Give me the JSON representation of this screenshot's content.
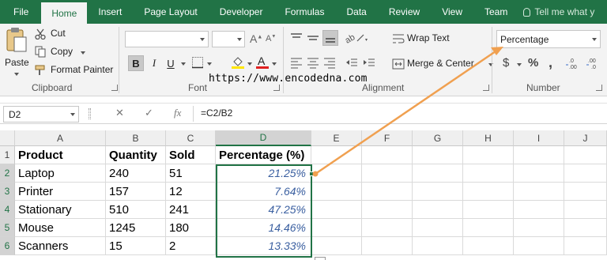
{
  "tabs": [
    "File",
    "Home",
    "Insert",
    "Page Layout",
    "Developer",
    "Formulas",
    "Data",
    "Review",
    "View",
    "Team"
  ],
  "tell_me": "Tell me what y",
  "clipboard": {
    "paste": "Paste",
    "cut": "Cut",
    "copy": "Copy",
    "format_painter": "Format Painter",
    "group_label": "Clipboard"
  },
  "font": {
    "bold": "B",
    "italic": "I",
    "underline": "U",
    "font_color_glyph": "A",
    "group_label": "Font"
  },
  "alignment": {
    "wrap_text": "Wrap Text",
    "merge_center": "Merge & Center",
    "group_label": "Alignment"
  },
  "number": {
    "format": "Percentage",
    "currency": "$",
    "percent": "%",
    "comma": ",",
    "group_label": "Number"
  },
  "watermark": "https://www.encodedna.com",
  "formula_bar": {
    "name_box": "D2",
    "fx": "fx",
    "formula": "=C2/B2"
  },
  "columns": [
    "A",
    "B",
    "C",
    "D",
    "E",
    "F",
    "G",
    "H",
    "I",
    "J"
  ],
  "rows": [
    "1",
    "2",
    "3",
    "4",
    "5",
    "6"
  ],
  "table": {
    "headers": [
      "Product",
      "Quantity",
      "Sold",
      "Percentage (%)"
    ],
    "rows": [
      [
        "Laptop",
        "240",
        "51",
        "21.25%"
      ],
      [
        "Printer",
        "157",
        "12",
        "7.64%"
      ],
      [
        "Stationary",
        "510",
        "241",
        "47.25%"
      ],
      [
        "Mouse",
        "1245",
        "180",
        "14.46%"
      ],
      [
        "Scanners",
        "15",
        "2",
        "13.33%"
      ]
    ]
  },
  "colors": {
    "ribbon_green": "#217346",
    "arrow_orange": "#f0a050",
    "percent_text": "#3a5fa0"
  }
}
